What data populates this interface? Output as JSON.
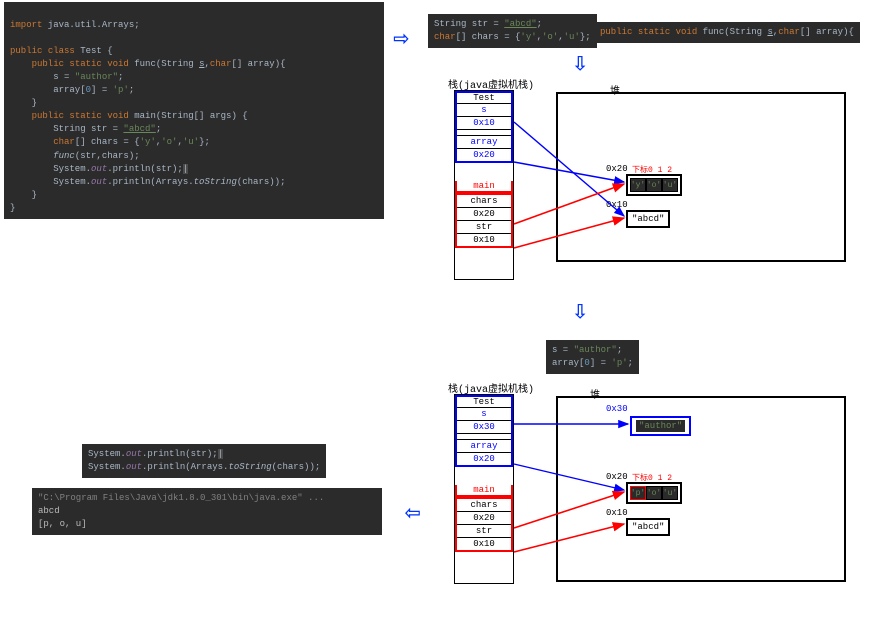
{
  "code_main": {
    "l1": "import java.util.Arrays;",
    "l2": "",
    "l3": "public class Test {",
    "l4": "    public static void func(String s,char[] array){",
    "l5": "        s = \"author\";",
    "l6": "        array[0] = 'p';",
    "l7": "    }",
    "l8": "    public static void main(String[] args) {",
    "l9": "        String str = \"abcd\";",
    "l10": "        char[] chars = {'y','o','u'};",
    "l11": "        func(str,chars);",
    "l12": "        System.out.println(str);",
    "l13": "        System.out.println(Arrays.toString(chars));",
    "l14": "    }",
    "l15": "}"
  },
  "snippet_top": {
    "l1": "String str = \"abcd\";",
    "l2": "char[] chars = {'y','o','u'};"
  },
  "func_sig": "public static void func(String s,char[] array){",
  "snippet_mid": {
    "l1": "s = \"author\";",
    "l2": "array[0] = 'p';"
  },
  "snippet_print": {
    "l1": "System.out.println(str);",
    "l2": "System.out.println(Arrays.toString(chars));"
  },
  "console": {
    "path": "\"C:\\Program Files\\Java\\jdk1.8.0_301\\bin\\java.exe\" ...",
    "out1": "abcd",
    "out2": "[p, o, u]"
  },
  "labels": {
    "stack": "栈(java虚拟机栈)",
    "heap": "堆",
    "idx": "下标0   1   2"
  },
  "stack1": {
    "funcFrame": {
      "name": "Test",
      "s": "s",
      "s_addr": "0x10",
      "arr": "array",
      "arr_addr": "0x20"
    },
    "mainFrame": {
      "name": "main",
      "chars": "chars",
      "chars_addr": "0x20",
      "str": "str",
      "str_addr": "0x10"
    }
  },
  "stack2": {
    "funcFrame": {
      "name": "Test",
      "s": "s",
      "s_addr": "0x30",
      "arr": "array",
      "arr_addr": "0x20"
    },
    "mainFrame": {
      "name": "main",
      "chars": "chars",
      "chars_addr": "0x20",
      "str": "str",
      "str_addr": "0x10"
    }
  },
  "heap1": {
    "arr_addr": "0x20",
    "arr": [
      "'y'",
      "'o'",
      "'u'"
    ],
    "str_addr": "0x10",
    "str": "\"abcd\""
  },
  "heap2": {
    "auth_addr": "0x30",
    "auth": "\"author\"",
    "arr_addr": "0x20",
    "arr": [
      "'p'",
      "'o'",
      "'u'"
    ],
    "str_addr": "0x10",
    "str": "\"abcd\""
  }
}
